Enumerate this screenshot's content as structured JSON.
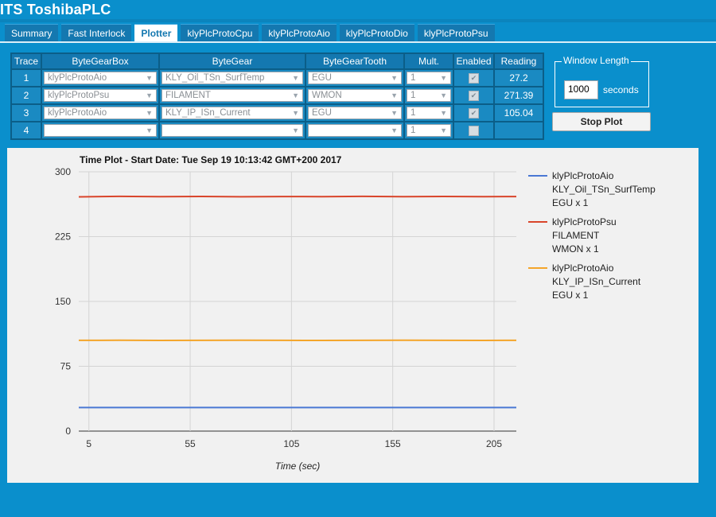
{
  "app": {
    "title": "ITS ToshibaPLC"
  },
  "tabs": [
    {
      "label": "Summary"
    },
    {
      "label": "Fast Interlock"
    },
    {
      "label": "Plotter"
    },
    {
      "label": "klyPlcProtoCpu"
    },
    {
      "label": "klyPlcProtoAio"
    },
    {
      "label": "klyPlcProtoDio"
    },
    {
      "label": "klyPlcProtoPsu"
    }
  ],
  "active_tab": "Plotter",
  "table": {
    "headers": [
      "Trace",
      "ByteGearBox",
      "ByteGear",
      "ByteGearTooth",
      "Mult.",
      "Enabled",
      "Reading"
    ],
    "rows": [
      {
        "trace": "1",
        "box": "klyPlcProtoAio",
        "gear": "KLY_Oil_TSn_SurfTemp",
        "tooth": "EGU",
        "mult": "1",
        "enabled": true,
        "reading": "27.2"
      },
      {
        "trace": "2",
        "box": "klyPlcProtoPsu",
        "gear": "FILAMENT",
        "tooth": "WMON",
        "mult": "1",
        "enabled": true,
        "reading": "271.39"
      },
      {
        "trace": "3",
        "box": "klyPlcProtoAio",
        "gear": "KLY_IP_ISn_Current",
        "tooth": "EGU",
        "mult": "1",
        "enabled": true,
        "reading": "105.04"
      },
      {
        "trace": "4",
        "box": "",
        "gear": "",
        "tooth": "",
        "mult": "1",
        "enabled": false,
        "reading": ""
      }
    ]
  },
  "window_length": {
    "legend": "Window Length",
    "value": "1000",
    "unit": "seconds"
  },
  "stop_button": {
    "label": "Stop Plot"
  },
  "icons": {
    "select_arrow": "chevron-down-icon",
    "checkbox": "check-icon"
  },
  "colors": {
    "background": "#0a8fcc",
    "series1": "#4a78d4",
    "series2": "#d9452b",
    "series3": "#f4a52a"
  },
  "plot": {
    "title": "Time Plot - Start Date: Tue Sep 19 10:13:42 GMT+200 2017",
    "legend": [
      {
        "lines": [
          "klyPlcProtoAio",
          "KLY_Oil_TSn_SurfTemp",
          "EGU x 1"
        ],
        "color": "#4a78d4"
      },
      {
        "lines": [
          "klyPlcProtoPsu",
          "FILAMENT",
          "WMON x 1"
        ],
        "color": "#d9452b"
      },
      {
        "lines": [
          "klyPlcProtoAio",
          "KLY_IP_ISn_Current",
          "EGU x 1"
        ],
        "color": "#f4a52a"
      }
    ]
  },
  "chart_data": {
    "type": "line",
    "title": "Time Plot - Start Date: Tue Sep 19 10:13:42 GMT+200 2017",
    "xlabel": "Time (sec)",
    "ylabel": "",
    "xlim": [
      0,
      216
    ],
    "ylim": [
      0,
      300
    ],
    "xticks": [
      5,
      55,
      105,
      155,
      205
    ],
    "yticks": [
      0,
      75,
      150,
      225,
      300
    ],
    "grid": true,
    "legend_position": "right",
    "x": [
      0,
      20,
      40,
      60,
      80,
      100,
      120,
      140,
      160,
      180,
      200,
      216
    ],
    "series": [
      {
        "name": "klyPlcProtoAio KLY_Oil_TSn_SurfTemp EGU x 1",
        "color": "#4a78d4",
        "values": [
          27.2,
          27.2,
          27.2,
          27.2,
          27.2,
          27.2,
          27.2,
          27.2,
          27.2,
          27.2,
          27.2,
          27.2
        ]
      },
      {
        "name": "klyPlcProtoPsu FILAMENT WMON x 1",
        "color": "#d9452b",
        "values": [
          271.0,
          271.6,
          271.2,
          271.5,
          271.1,
          271.4,
          271.3,
          271.6,
          271.2,
          271.5,
          271.3,
          271.4
        ]
      },
      {
        "name": "klyPlcProtoAio KLY_IP_ISn_Current EGU x 1",
        "color": "#f4a52a",
        "values": [
          105.0,
          105.1,
          104.9,
          105.0,
          105.1,
          105.0,
          104.9,
          105.0,
          105.1,
          105.0,
          104.9,
          105.0
        ]
      }
    ]
  }
}
